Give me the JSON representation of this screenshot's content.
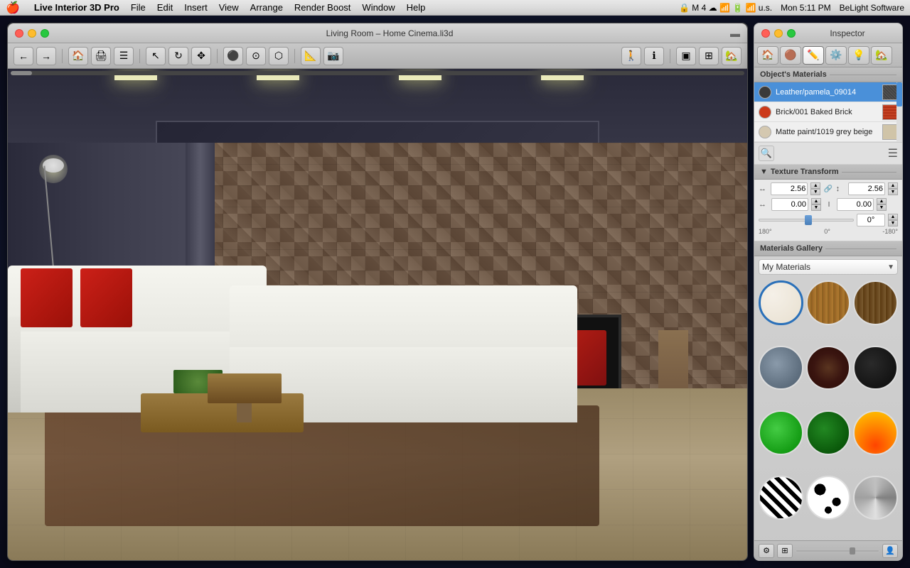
{
  "menubar": {
    "apple": "🍎",
    "app_name": "Live Interior 3D Pro",
    "menus": [
      "File",
      "Edit",
      "Insert",
      "View",
      "Arrange",
      "Render Boost",
      "Window",
      "Help"
    ],
    "right_items": [
      "Mon 5:11 PM",
      "BeLight Software"
    ],
    "time": "Mon 5:11 PM",
    "company": "BeLight Software"
  },
  "main_window": {
    "title": "Living Room – Home Cinema.li3d",
    "traffic_lights": [
      "close",
      "minimize",
      "maximize"
    ]
  },
  "inspector": {
    "title": "Inspector",
    "tabs": [
      "🏠",
      "🟤",
      "✏️",
      "⚙️",
      "💡",
      "🏡"
    ],
    "objects_materials": {
      "label": "Object's Materials",
      "materials": [
        {
          "name": "Leather/pamela_09014",
          "color": "#3a3a3a"
        },
        {
          "name": "Brick/001 Baked Brick",
          "color": "#cc3a1a"
        },
        {
          "name": "Matte paint/1019 grey beige",
          "color": "#d4c8b0"
        }
      ]
    },
    "texture_transform": {
      "label": "Texture Transform",
      "width_value": "2.56",
      "height_value": "2.56",
      "offset_x": "0.00",
      "offset_y": "0.00",
      "rotation_value": "0°",
      "rotation_min": "180°",
      "rotation_center": "0°",
      "rotation_max": "-180°"
    },
    "materials_gallery": {
      "label": "Materials Gallery",
      "dropdown_value": "My Materials",
      "swatches": [
        {
          "id": "white-marble",
          "type": "swatch-white-marble",
          "selected": true
        },
        {
          "id": "wood-light",
          "type": "swatch-wood-light",
          "selected": false
        },
        {
          "id": "wood-dark2",
          "type": "swatch-wood-dark",
          "selected": false
        },
        {
          "id": "stone",
          "type": "swatch-stone",
          "selected": false
        },
        {
          "id": "brown-dark",
          "type": "swatch-brown-dark",
          "selected": false
        },
        {
          "id": "black",
          "type": "swatch-black",
          "selected": false
        },
        {
          "id": "green-bright",
          "type": "swatch-green-bright",
          "selected": false
        },
        {
          "id": "green-dark",
          "type": "swatch-green-dark",
          "selected": false
        },
        {
          "id": "fire",
          "type": "swatch-fire",
          "selected": false
        },
        {
          "id": "zebra",
          "type": "swatch-zebra",
          "selected": false
        },
        {
          "id": "spots",
          "type": "swatch-spots",
          "selected": false
        },
        {
          "id": "chrome",
          "type": "swatch-chrome",
          "selected": false
        }
      ]
    }
  }
}
